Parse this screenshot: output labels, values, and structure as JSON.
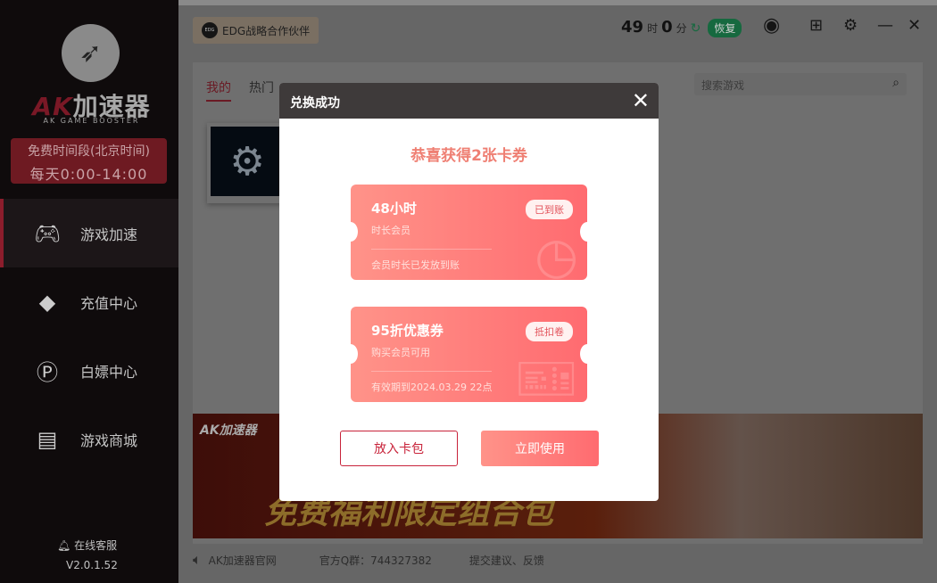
{
  "sidebar": {
    "brand": {
      "ak": "AK",
      "name": "加速器",
      "sub": "AK GAME BOOSTER"
    },
    "free_period": {
      "line1": "免费时间段(北京时间)",
      "line2": "每天0:00-14:00"
    },
    "items": [
      {
        "label": "游戏加速",
        "icon": "gamepad-icon",
        "active": true
      },
      {
        "label": "充值中心",
        "icon": "diamond-icon"
      },
      {
        "label": "白嫖中心",
        "icon": "flag-icon"
      },
      {
        "label": "游戏商城",
        "icon": "store-icon"
      }
    ],
    "service": "在线客服",
    "version": "V2.0.1.52"
  },
  "header": {
    "partner": "EDG战略合作伙伴",
    "partner_logo": "EDG",
    "timer": {
      "hours": "49",
      "hours_unit": "时",
      "minutes": "0",
      "minutes_unit": "分"
    },
    "restore": "恢复"
  },
  "main": {
    "tabs": [
      {
        "label": "我的",
        "active": true
      },
      {
        "label": "热门"
      }
    ],
    "search_placeholder": "搜索游戏",
    "banner": {
      "logo": "AK加速器",
      "title": "免费福利限定组合包"
    },
    "footer": {
      "site": "AK加速器官网",
      "qq": "官方Q群：744327382",
      "feedback": "提交建议、反馈"
    }
  },
  "modal": {
    "title": "兑换成功",
    "congrats": "恭喜获得2张卡券",
    "tickets": [
      {
        "title": "48小时",
        "subtitle": "时长会员",
        "badge": "已到账",
        "note": "会员时长已发放到账"
      },
      {
        "title": "95折优惠券",
        "subtitle": "购买会员可用",
        "badge": "抵扣卷",
        "note": "有效期到2024.03.29 22点"
      }
    ],
    "wallet_button": "放入卡包",
    "use_button": "立即使用"
  },
  "colors": {
    "accent": "#c8233a",
    "ticket": "#ff7a7c",
    "restore": "#1f9a5e"
  }
}
